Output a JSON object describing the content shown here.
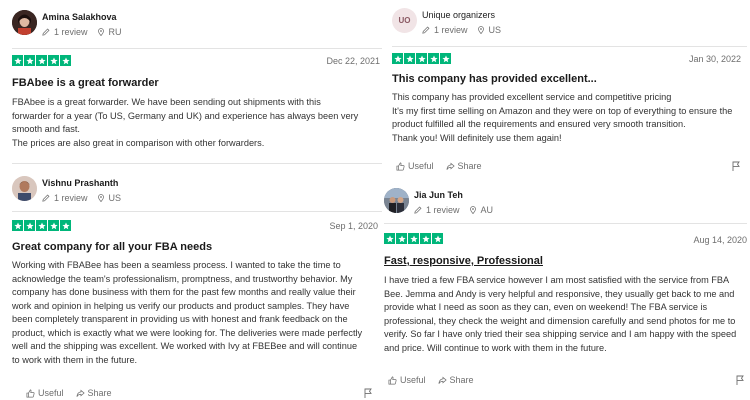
{
  "reviews": [
    {
      "reviewer": "Amina Salakhova",
      "review_count": "1 review",
      "country": "RU",
      "date": "Dec 22, 2021",
      "title": "FBAbee is a great forwarder",
      "body": "FBAbee is a great forwarder. We have been sending out shipments with this forwarder for a year (To US, Germany and UK) and experience has always been very smooth and fast.\nThe prices are also great in comparison with other forwarders.",
      "rating": 5
    },
    {
      "reviewer": "Unique organizers",
      "avatar_initials": "UO",
      "review_count": "1 review",
      "country": "US",
      "date": "Jan 30, 2022",
      "title": "This company has provided excellent...",
      "body": "This company has provided excellent service and competitive pricing\nIt's my first time selling on Amazon and they were on top of everything to ensure the product fulfilled all the requirements and ensured very smooth transition.\nThank you! Will definitely use them again!",
      "useful_label": "Useful",
      "share_label": "Share",
      "rating": 5
    },
    {
      "reviewer": "Vishnu Prashanth",
      "review_count": "1 review",
      "country": "US",
      "date": "Sep 1, 2020",
      "title": "Great company for all your FBA needs",
      "body": "Working with FBABee has been a seamless process. I wanted to take the time to acknowledge the team's professionalism, promptness, and trustworthy behavior. My company has done business with them for the past few months and really value their work and opinion in helping us verify our products and product samples. They have been completely transparent in providing us with honest and frank feedback on the product, which is exactly what we were looking for. The deliveries were made perfectly well and the shipping was excellent. We worked with Ivy at FBEBee and will continue to work with them in the future.",
      "useful_label": "Useful",
      "share_label": "Share",
      "rating": 5
    },
    {
      "reviewer": "Jia Jun Teh",
      "review_count": "1 review",
      "country": "AU",
      "date": "Aug 14, 2020",
      "title": "Fast, responsive, Professional",
      "body": "I have tried a few FBA service however I am most satisfied with the service from FBA Bee. Jemma and Andy is very helpful and responsive, they usually get back to me and provide what I need as soon as they can, even on weekend! The FBA service is professional, they check the weight and dimension carefully and send photos for me to verify. So far I have only tried their sea shipping service and I am happy with the speed and price. Will continue to work with them in the future.",
      "useful_label": "Useful",
      "share_label": "Share",
      "rating": 5
    }
  ],
  "colors": {
    "star_green": "#00b67a",
    "text_muted": "#6e6e6e",
    "divider": "#e3e3e3"
  },
  "icons": {
    "review_count": "pencil-icon",
    "country": "location-pin-icon",
    "star": "star-icon",
    "useful": "thumbs-up-icon",
    "share": "share-icon",
    "report": "flag-icon"
  }
}
